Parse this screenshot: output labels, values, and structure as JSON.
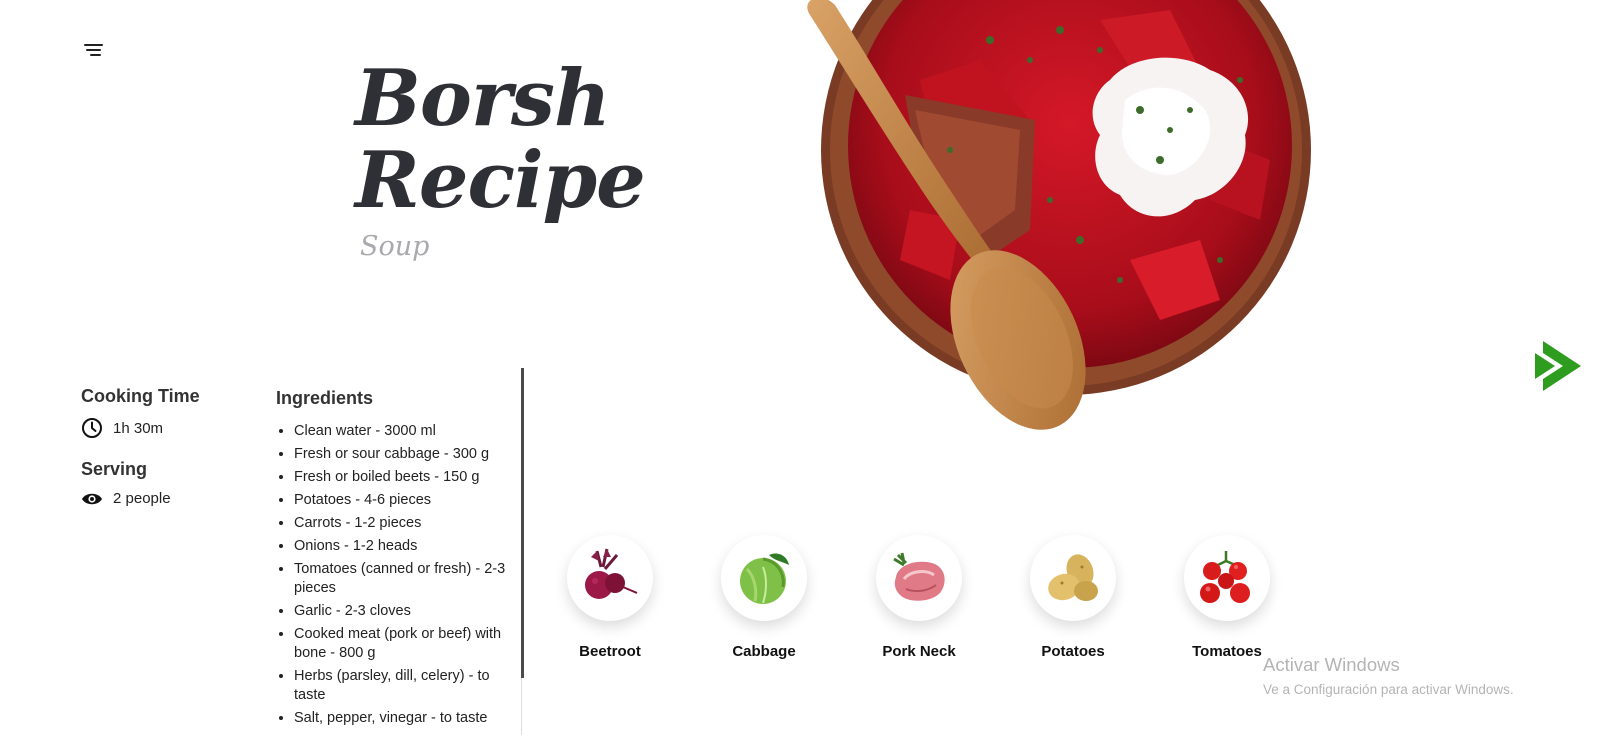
{
  "header": {
    "title_line1": "Borsh",
    "title_line2": "Recipe",
    "subtitle": "Soup"
  },
  "hero": {
    "image": "borsh-bowl-with-wooden-spoon"
  },
  "navigation": {
    "next_icon": "chevron-double-right-icon",
    "accent_color": "#2e9c1e"
  },
  "info": {
    "cooking_time_label": "Cooking Time",
    "cooking_time_value": "1h 30m",
    "serving_label": "Serving",
    "serving_value": "2 people"
  },
  "ingredients": {
    "heading": "Ingredients",
    "items": [
      "Clean water - 3000 ml",
      "Fresh or sour cabbage - 300 g",
      "Fresh or boiled beets - 150 g",
      "Potatoes - 4-6 pieces",
      "Carrots - 1-2 pieces",
      "Onions - 1-2 heads",
      "Tomatoes (canned or fresh) - 2-3 pieces",
      "Garlic - 2-3 cloves",
      "Cooked meat (pork or beef) with bone - 800 g",
      "Herbs (parsley, dill, celery) - to taste",
      "Salt, pepper, vinegar - to taste"
    ]
  },
  "ingredient_cards": [
    {
      "label": "Beetroot",
      "icon": "beetroot-icon"
    },
    {
      "label": "Cabbage",
      "icon": "cabbage-icon"
    },
    {
      "label": "Pork Neck",
      "icon": "pork-neck-icon"
    },
    {
      "label": "Potatoes",
      "icon": "potatoes-icon"
    },
    {
      "label": "Tomatoes",
      "icon": "tomatoes-icon"
    }
  ],
  "watermark": {
    "title": "Activar Windows",
    "subtitle": "Ve a Configuración para activar Windows."
  }
}
